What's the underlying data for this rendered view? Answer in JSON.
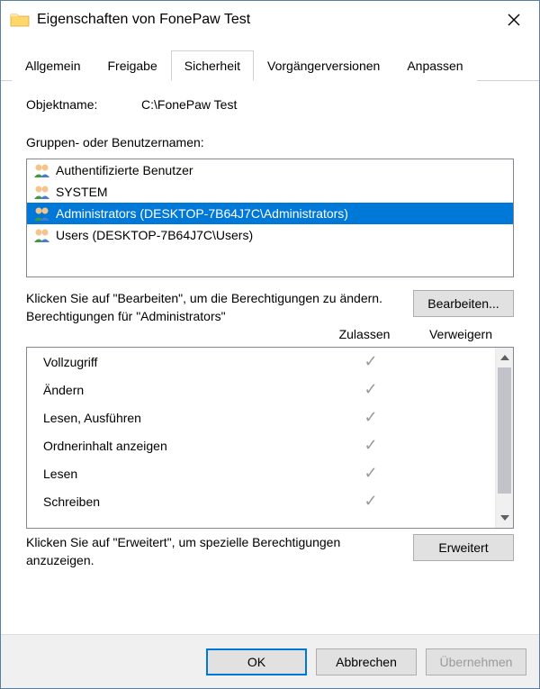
{
  "window": {
    "title": "Eigenschaften von FonePaw Test"
  },
  "tabs": [
    {
      "label": "Allgemein",
      "active": false
    },
    {
      "label": "Freigabe",
      "active": false
    },
    {
      "label": "Sicherheit",
      "active": true
    },
    {
      "label": "Vorgängerversionen",
      "active": false
    },
    {
      "label": "Anpassen",
      "active": false
    }
  ],
  "object_name": {
    "label": "Objektname:",
    "value": "C:\\FonePaw Test"
  },
  "groups": {
    "label": "Gruppen- oder Benutzernamen:",
    "items": [
      {
        "label": "Authentifizierte Benutzer",
        "selected": false
      },
      {
        "label": "SYSTEM",
        "selected": false
      },
      {
        "label": "Administrators (DESKTOP-7B64J7C\\Administrators)",
        "selected": true
      },
      {
        "label": "Users (DESKTOP-7B64J7C\\Users)",
        "selected": false
      }
    ]
  },
  "edit_hint": "Klicken Sie auf \"Bearbeiten\", um die Berechtigungen zu ändern.",
  "edit_button": "Bearbeiten...",
  "permissions_for": "Berechtigungen für \"Administrators\"",
  "perm_columns": {
    "allow": "Zulassen",
    "deny": "Verweigern"
  },
  "permissions": [
    {
      "name": "Vollzugriff",
      "allow": true,
      "deny": false
    },
    {
      "name": "Ändern",
      "allow": true,
      "deny": false
    },
    {
      "name": "Lesen, Ausführen",
      "allow": true,
      "deny": false
    },
    {
      "name": "Ordnerinhalt anzeigen",
      "allow": true,
      "deny": false
    },
    {
      "name": "Lesen",
      "allow": true,
      "deny": false
    },
    {
      "name": "Schreiben",
      "allow": true,
      "deny": false
    }
  ],
  "advanced_hint": "Klicken Sie auf \"Erweitert\", um spezielle Berechtigungen anzuzeigen.",
  "advanced_button": "Erweitert",
  "footer": {
    "ok": "OK",
    "cancel": "Abbrechen",
    "apply": "Übernehmen"
  }
}
